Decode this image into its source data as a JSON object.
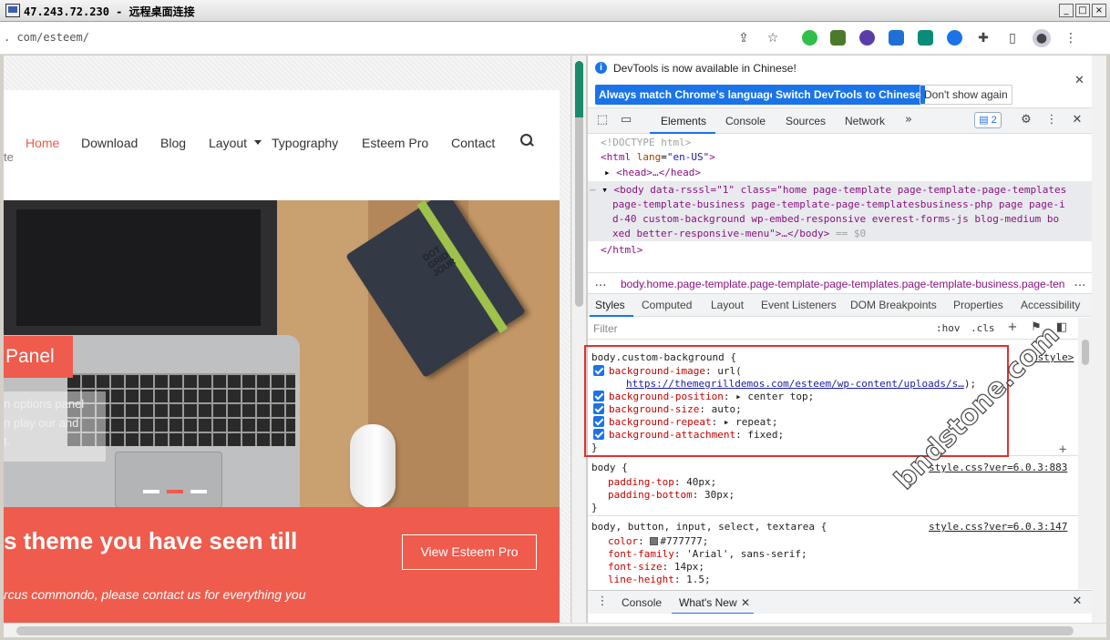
{
  "remote_desktop": {
    "title": "47.243.72.230 - 远程桌面连接",
    "buttons": [
      "_",
      "□",
      "×"
    ]
  },
  "browser": {
    "url": ". com/esteem/"
  },
  "site": {
    "nav": [
      "Home",
      "Download",
      "Blog",
      "Layout",
      "Typography",
      "Esteem Pro",
      "Contact"
    ],
    "tagline_fragment": "te",
    "slider": {
      "caption_title": "Panel",
      "caption_lines": [
        "n options panel",
        "n play our and",
        "t."
      ],
      "notebook_text": "DOT GRID JOUR",
      "active_dot": 2,
      "dot_count": 3
    },
    "cta": {
      "title": "s theme you have seen till",
      "button": "View Esteem Pro",
      "text": "rcus commondo, please contact us for everything you"
    }
  },
  "devtools": {
    "notice": {
      "text": "DevTools is now available in Chinese!",
      "btn_match": "Always match Chrome's language",
      "btn_switch": "Switch DevTools to Chinese",
      "btn_dismiss": "Don't show again"
    },
    "tabs": [
      "Elements",
      "Console",
      "Sources",
      "Network"
    ],
    "issues_count": "2",
    "dom": {
      "doctype": "<!DOCTYPE html>",
      "html_open_tag": "<html",
      "html_attr_name": "lang",
      "html_attr_value": "\"en-US\"",
      "html_open_end": ">",
      "head": "<head>…</head>",
      "body_line1": "body data-rsssl=\"1\" class=\"home page-template page-template-page-templates",
      "body_line2": "page-template-business page-template-page-templatesbusiness-php page page-i",
      "body_line3": "d-40 custom-background wp-embed-responsive everest-forms-js  blog-medium bo",
      "body_line4": "xed better-responsive-menu\">…</body>",
      "body_eq": "== $0",
      "html_close": "</html>"
    },
    "breadcrumb": "body.home.page-template.page-template-page-templates.page-template-business.page-ten",
    "styles_tabs": [
      "Styles",
      "Computed",
      "Layout",
      "Event Listeners",
      "DOM Breakpoints",
      "Properties",
      "Accessibility"
    ],
    "filter_placeholder": "Filter",
    "filter_hov": ":hov",
    "filter_cls": ".cls",
    "rules": {
      "r1_selector": "body.custom-background {",
      "r1_source": "<style>",
      "bg_image_prop": "background-image",
      "bg_image_val": "url(",
      "bg_image_url": "https://themegrilldemos.com/esteem/wp-content/uploads/s…",
      "bg_image_end": ");",
      "bg_position_prop": "background-position",
      "bg_position_val": "center top;",
      "bg_size_prop": "background-size",
      "bg_size_val": "auto;",
      "bg_repeat_prop": "background-repeat",
      "bg_repeat_val": "repeat;",
      "bg_attach_prop": "background-attachment",
      "bg_attach_val": "fixed;",
      "close": "}",
      "r2_selector": "body {",
      "r2_source": "style.css?ver=6.0.3:883",
      "pt_prop": "padding-top",
      "pt_val": "40px;",
      "pb_prop": "padding-bottom",
      "pb_val": "30px;",
      "r3_selector": "body, button, input, select, textarea {",
      "r3_source": "style.css?ver=6.0.3:147",
      "color_prop": "color",
      "color_val": "#777777;",
      "ff_prop": "font-family",
      "ff_val": "'Arial', sans-serif;",
      "fs_prop": "font-size",
      "fs_val": "14px;",
      "lh_prop": "line-height",
      "lh_val": "1.5;"
    },
    "drawer_tabs": [
      "Console",
      "What's New"
    ]
  },
  "watermark": "bndstone.com",
  "colors": {
    "accent_red": "#ef5b4c",
    "devtools_blue": "#1a73e8",
    "highlight_border": "#e0302c"
  }
}
